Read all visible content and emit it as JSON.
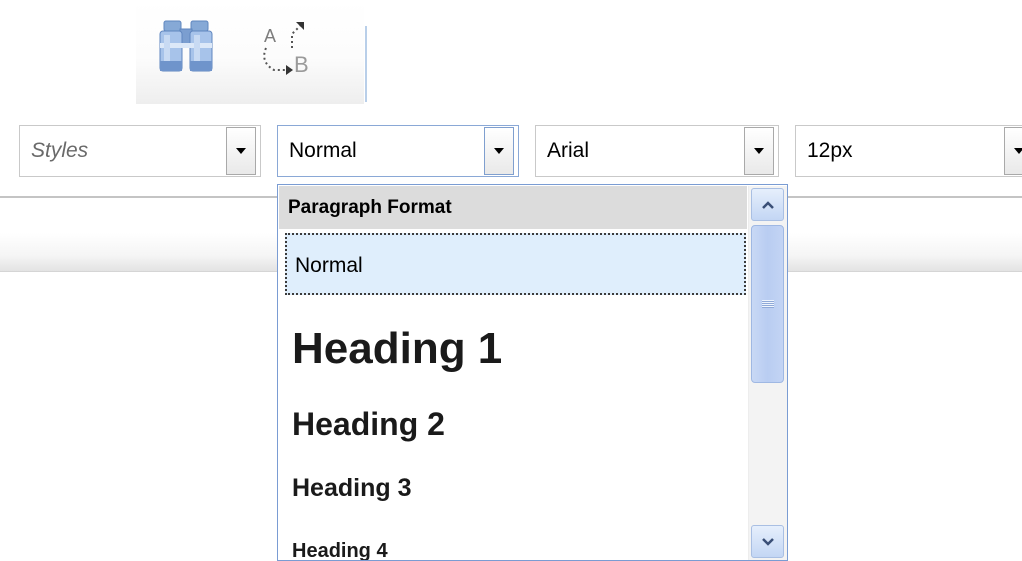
{
  "icon_toolbar": {
    "find_icon": "binoculars-icon",
    "replace_icon": "replace-a-b-icon",
    "replace_icon_letters": [
      "A",
      "B"
    ]
  },
  "format_toolbar": {
    "styles": {
      "placeholder": "Styles"
    },
    "format": {
      "value": "Normal"
    },
    "font": {
      "value": "Arial"
    },
    "size": {
      "value": "12px"
    }
  },
  "format_dropdown": {
    "header": "Paragraph Format",
    "items": [
      {
        "label": "Normal",
        "selected": true
      },
      {
        "label": "Heading 1"
      },
      {
        "label": "Heading 2"
      },
      {
        "label": "Heading 3"
      },
      {
        "label": "Heading 4"
      }
    ]
  },
  "colors": {
    "accent_border": "#7a9cd3",
    "selected_bg": "#dfeefc",
    "header_bg": "#dcdcdc"
  }
}
